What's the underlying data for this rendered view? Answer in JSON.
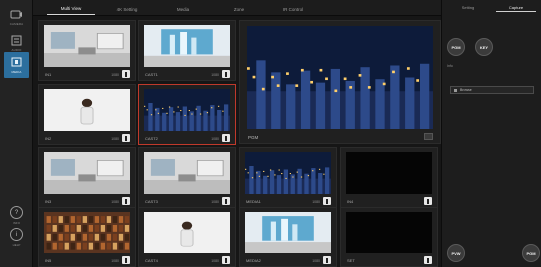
{
  "rail": {
    "items": [
      {
        "icon": "camera-icon",
        "label": "CAMERA"
      },
      {
        "icon": "audio-icon",
        "label": "AUDIO"
      },
      {
        "icon": "media-icon",
        "label": "MEDIA"
      }
    ],
    "bottom": [
      {
        "icon": "info-icon",
        "label": "INFO"
      },
      {
        "icon": "help-icon",
        "label": "HELP"
      }
    ]
  },
  "tabs": [
    "Multi View",
    "4K Setting",
    "Media",
    "Zone",
    "IR Control"
  ],
  "cells": [
    {
      "name": "IN1",
      "meta": "1080",
      "thumb": "room"
    },
    {
      "name": "CAST1",
      "meta": "1080",
      "thumb": "skyline"
    },
    {
      "name": "IN2",
      "meta": "1080",
      "thumb": "presenter"
    },
    {
      "name": "CAST2",
      "meta": "1080",
      "thumb": "night"
    },
    {
      "name": "IN3",
      "meta": "1080",
      "thumb": "room"
    },
    {
      "name": "CAST3",
      "meta": "1080",
      "thumb": "room"
    },
    {
      "name": "MEDIA1",
      "meta": "1080",
      "thumb": "night"
    },
    {
      "name": "IN4",
      "meta": "",
      "thumb": "black"
    },
    {
      "name": "IN5",
      "meta": "1080",
      "thumb": "library"
    },
    {
      "name": "CAST4",
      "meta": "1080",
      "thumb": "presenter"
    },
    {
      "name": "MEDIA2",
      "meta": "1080",
      "thumb": "skyline"
    },
    {
      "name": "SET",
      "meta": "",
      "thumb": "black"
    }
  ],
  "preview": {
    "name": "PGM"
  },
  "panel": {
    "tabs": [
      "Setting",
      "Capture"
    ],
    "active_tab": 1,
    "pgm": "PGM",
    "key": "KEY",
    "info": "Info",
    "option": "Browse",
    "pvw": "PVW",
    "pgm_bottom": "PGM"
  }
}
